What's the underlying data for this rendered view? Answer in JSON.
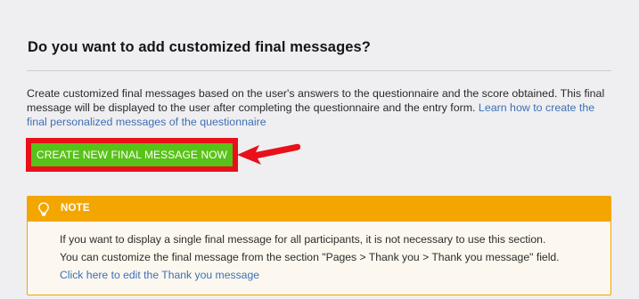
{
  "section": {
    "title": "Do you want to add customized final messages?",
    "description_text": "Create customized final messages based on the user's answers to the questionnaire and the score obtained. This final message will be displayed to the user after completing the questionnaire and the entry form. ",
    "learn_link": "Learn how to create the final personalized messages of the questionnaire",
    "cta_label": "CREATE NEW FINAL MESSAGE NOW"
  },
  "note": {
    "title": "NOTE",
    "line1": "If you want to display a single final message for all participants, it is not necessary to use this section.",
    "line2": "You can customize the final message from the section \"Pages > Thank you > Thank you message\" field.",
    "link": "Click here to edit the Thank you message"
  },
  "colors": {
    "accent_green": "#58c219",
    "highlight_red": "#e8101a",
    "note_orange": "#f4a600",
    "link_blue": "#3d6fb5"
  },
  "icons": {
    "note": "lightbulb-icon",
    "pointer": "red-arrow-icon"
  }
}
